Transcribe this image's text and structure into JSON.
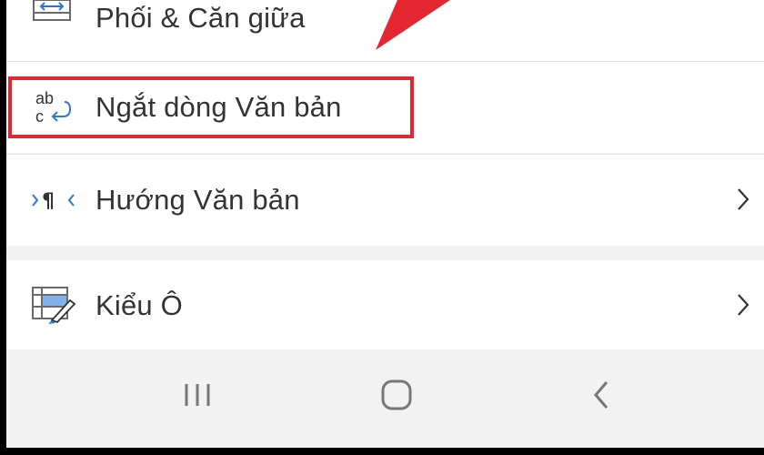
{
  "menu": {
    "items": [
      {
        "label": "Phối & Căn giữa",
        "icon": "merge-center-icon"
      },
      {
        "label": "Ngắt dòng Văn bản",
        "icon": "wrap-text-icon"
      },
      {
        "label": "Hướng Văn bản",
        "icon": "text-direction-icon",
        "has_submenu": true
      },
      {
        "label": "Kiểu Ô",
        "icon": "cell-style-icon",
        "has_submenu": true
      }
    ]
  },
  "annotation": {
    "highlight_color": "#e3262f",
    "arrow_color": "#e3262f"
  },
  "navbar": {
    "buttons": [
      "recent-apps-icon",
      "home-icon",
      "back-icon"
    ]
  },
  "colors": {
    "accent_blue": "#2b78d4",
    "text": "#333333",
    "background": "#f2f2f2"
  }
}
